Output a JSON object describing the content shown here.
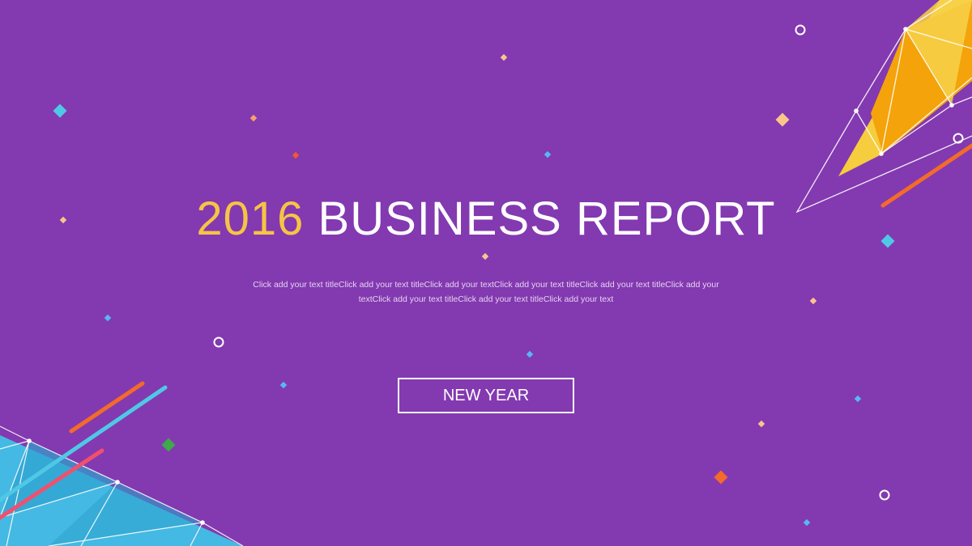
{
  "slide": {
    "title_year": "2016",
    "title_main": "BUSINESS REPORT",
    "subtitle": "Click add your text titleClick add your text titleClick add your textClick add your text titleClick add your text titleClick add your textClick add your text titleClick add your text titleClick add your text",
    "button_label": "NEW YEAR"
  },
  "colors": {
    "background": "#8339b0",
    "year_accent": "#f6c445",
    "title_text": "#ffffff",
    "button_border": "#ffffff",
    "triangle_yellow": "#f5cd3e",
    "triangle_orange": "#f4a30a",
    "triangle_cyan": "#44b9e3",
    "line_orange": "#f26b2b",
    "line_cyan": "#4fc8e6",
    "line_red": "#f0506e"
  }
}
